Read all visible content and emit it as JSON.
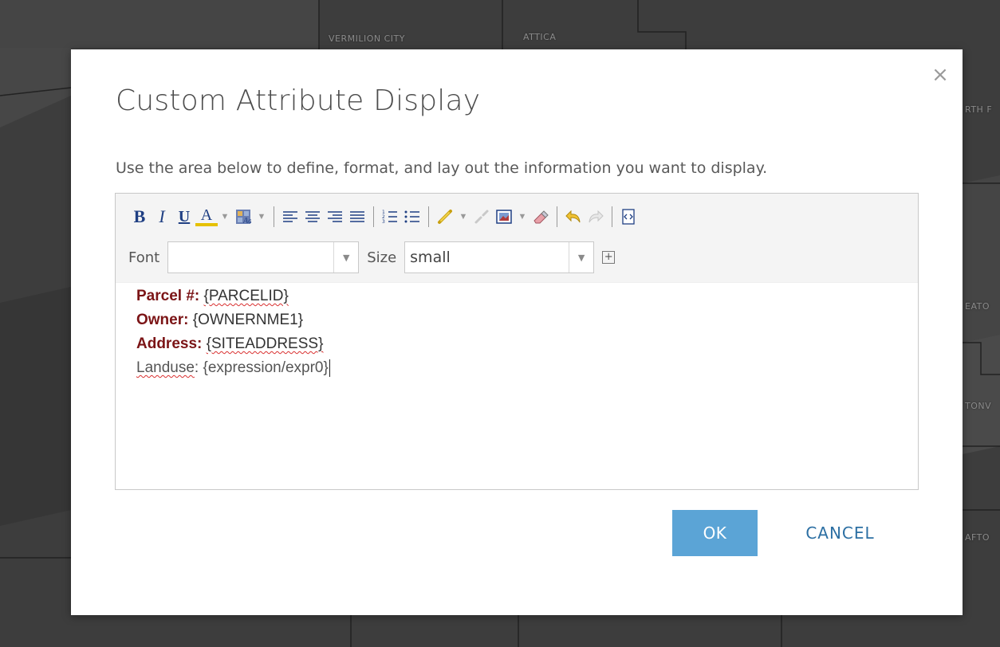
{
  "map": {
    "labels": [
      "VERMILION CITY",
      "ATTICA",
      "RTH F",
      "EATO",
      "TONV",
      "AFTO"
    ]
  },
  "dialog": {
    "title": "Custom Attribute Display",
    "close_glyph": "×",
    "instructions": "Use the area below to define, format, and lay out the information you want to display.",
    "toolbar": {
      "bold_label": "B",
      "italic_label": "I",
      "underline_label": "U",
      "font_color_label": "A",
      "font_label": "Font",
      "font_value": "",
      "size_label": "Size",
      "size_value": "small",
      "expand_glyph": "+",
      "icons": [
        "bold-icon",
        "italic-icon",
        "underline-icon",
        "font-color-icon",
        "highlight-icon",
        "align-left-icon",
        "align-center-icon",
        "align-right-icon",
        "align-justify-icon",
        "numbered-list-icon",
        "bulleted-list-icon",
        "link-icon",
        "unlink-icon",
        "insert-image-icon",
        "clear-format-icon",
        "undo-icon",
        "redo-icon",
        "view-source-icon"
      ]
    },
    "content": [
      {
        "label": "Parcel #:",
        "value": "{PARCELID}"
      },
      {
        "label": "Owner:",
        "value": "{OWNERNME1}"
      },
      {
        "label": "Address:",
        "value": "{SITEADDRESS}"
      },
      {
        "label": "Landuse",
        "sep": ":",
        "value": "{expression/expr0}"
      }
    ],
    "ok_label": "OK",
    "cancel_label": "CANCEL"
  },
  "colors": {
    "accent": "#5ba4d6",
    "label_red": "#7b1416",
    "link_blue": "#2c6fa3",
    "map_bg": "#3d3d3d"
  }
}
